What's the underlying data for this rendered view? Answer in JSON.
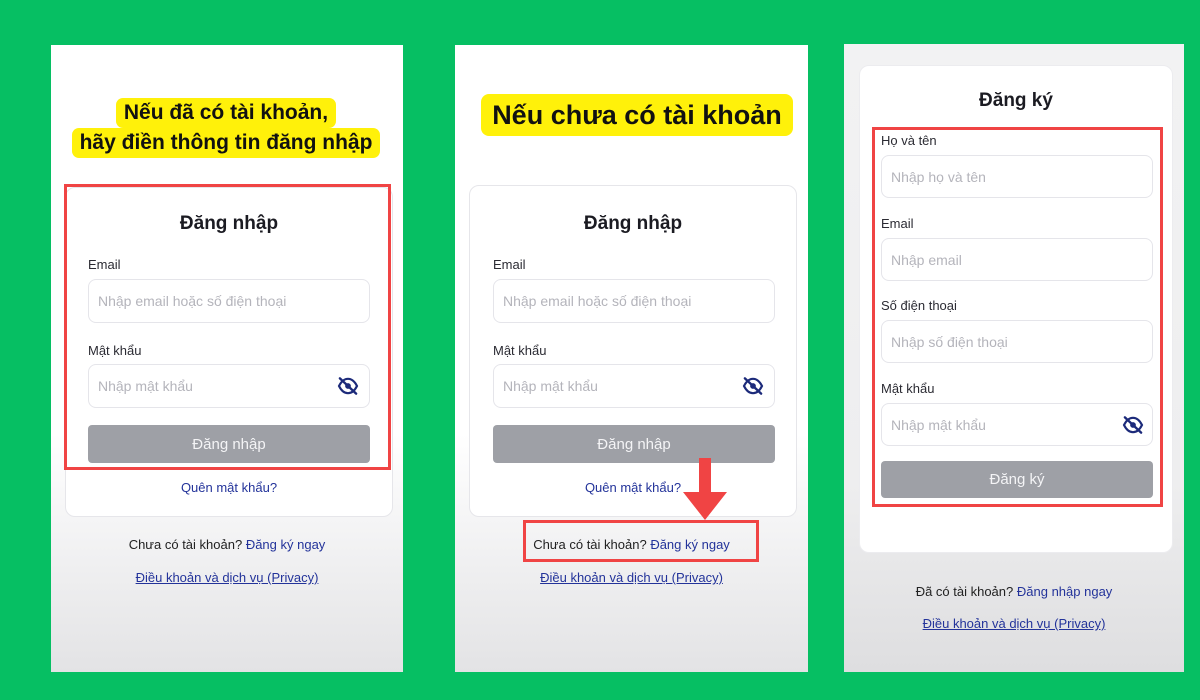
{
  "panel1": {
    "callout_line1": "Nếu đã có tài khoản,",
    "callout_line2": "hãy điền thông tin đăng nhập",
    "title": "Đăng nhập",
    "email_label": "Email",
    "email_placeholder": "Nhập email hoặc số điện thoại",
    "password_label": "Mật khẩu",
    "password_placeholder": "Nhập mật khẩu",
    "submit_label": "Đăng nhập",
    "forgot_label": "Quên mật khẩu?",
    "no_account_text": "Chưa có tài khoản?",
    "register_link": "Đăng ký ngay",
    "terms_link": "Điều khoản và dịch vụ (Privacy)"
  },
  "panel2": {
    "callout": "Nếu chưa có tài khoản",
    "title": "Đăng nhập",
    "email_label": "Email",
    "email_placeholder": "Nhập email hoặc số điện thoại",
    "password_label": "Mật khẩu",
    "password_placeholder": "Nhập mật khẩu",
    "submit_label": "Đăng nhập",
    "forgot_label": "Quên mật khẩu?",
    "no_account_text": "Chưa có tài khoản?",
    "register_link": "Đăng ký ngay",
    "terms_link": "Điều khoản và dịch vụ (Privacy)"
  },
  "panel3": {
    "title": "Đăng ký",
    "name_label": "Họ và tên",
    "name_placeholder": "Nhập họ và tên",
    "email_label": "Email",
    "email_placeholder": "Nhập email",
    "phone_label": "Số điện thoại",
    "phone_placeholder": "Nhập số điện thoại",
    "password_label": "Mật khẩu",
    "password_placeholder": "Nhập mật khẩu",
    "submit_label": "Đăng ký",
    "has_account_text": "Đã có tài khoản?",
    "login_link": "Đăng nhập ngay",
    "terms_link": "Điều khoản và dịch vụ (Privacy)"
  },
  "colors": {
    "background": "#06bf63",
    "callout": "#fff10a",
    "highlight": "#f04444",
    "link": "#23339a",
    "button": "#9ea0a6"
  },
  "icons": {
    "password_toggle": "eye-slash-icon",
    "pointer": "arrow-down-icon"
  }
}
